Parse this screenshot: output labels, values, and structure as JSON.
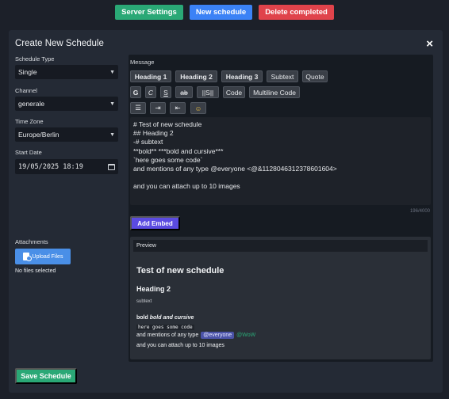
{
  "topbar": {
    "server_settings": "Server Settings",
    "new_schedule": "New schedule",
    "delete_completed": "Delete completed"
  },
  "modal": {
    "title": "Create New Schedule",
    "close": "×"
  },
  "form": {
    "schedule_type_label": "Schedule Type",
    "schedule_type_value": "Single",
    "channel_label": "Channel",
    "channel_value": "generale",
    "timezone_label": "Time Zone",
    "timezone_value": "Europe/Berlin",
    "start_date_label": "Start Date",
    "start_date_value": "19/05/2025 18:19",
    "attachments_label": "Attachments",
    "upload_label": "Upload Files",
    "no_files": "No files selected",
    "save_label": "Save Schedule"
  },
  "message": {
    "label": "Message",
    "toolbar_row1": [
      "Heading 1",
      "Heading 2",
      "Heading 3",
      "Subtext",
      "Quote"
    ],
    "toolbar_row2": [
      "G",
      "C",
      "S",
      "ab",
      "||S||",
      "Code",
      "Multiline Code"
    ],
    "toolbar_row3_icons": [
      "list-icon",
      "indent-icon",
      "outdent-icon",
      "emoji-icon"
    ],
    "lines": [
      "# Test of new schedule",
      "## Heading 2",
      "-# subtext",
      "**bold** ***bold and cursive***",
      "`here goes some code`",
      "and mentions of any type @everyone <@&1128046312378601604>",
      "",
      "and you can attach up to 10 images"
    ],
    "counter": "196/4000",
    "add_embed": "Add Embed"
  },
  "preview": {
    "label": "Preview",
    "h1": "Test of new schedule",
    "h2": "Heading 2",
    "subtext": "subtext",
    "bold": "bold",
    "bold_italic": "bold and cursive",
    "code": "here goes some code",
    "mention_prefix": "and mentions of any type",
    "mention_everyone": "@everyone",
    "mention_role": "@WoW",
    "images_line": "and you can attach up to 10 images"
  }
}
